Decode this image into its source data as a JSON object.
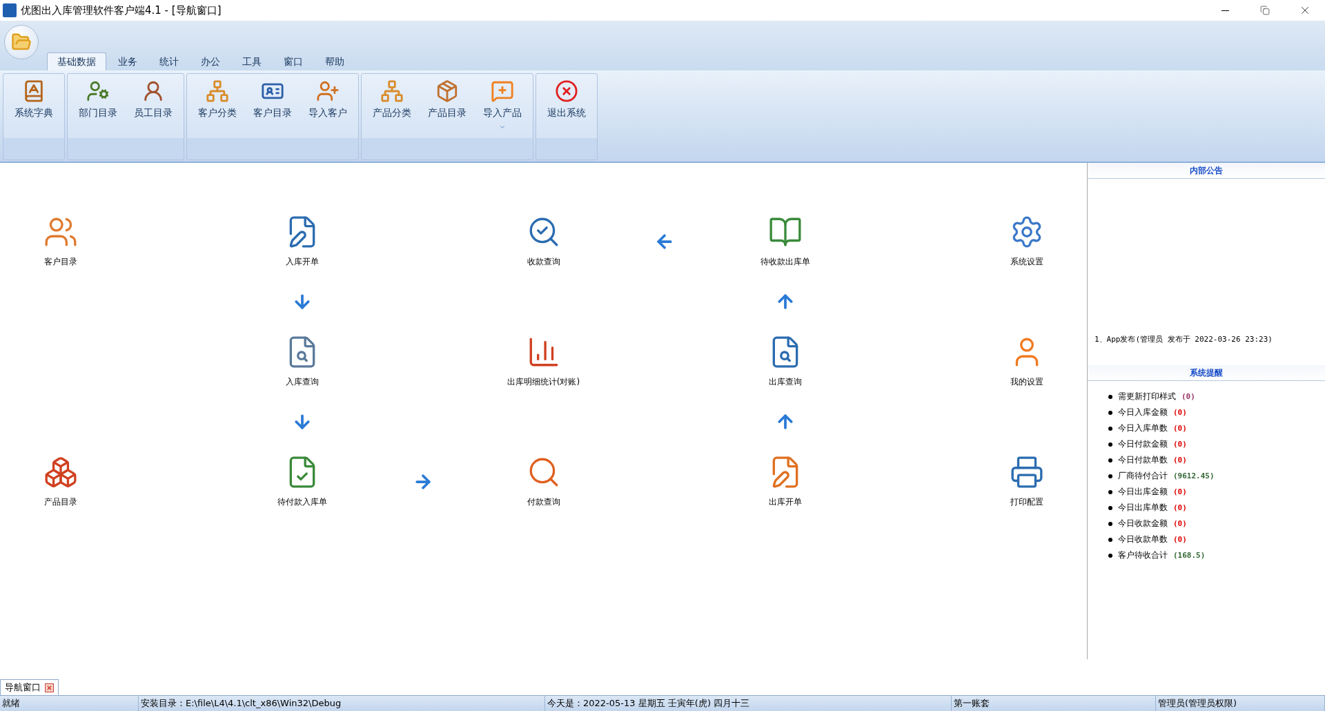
{
  "window": {
    "title": "优图出入库管理软件客户端4.1 - [导航窗口]"
  },
  "ribbon": {
    "tabs": [
      {
        "label": "基础数据",
        "selected": true
      },
      {
        "label": "业务",
        "selected": false
      },
      {
        "label": "统计",
        "selected": false
      },
      {
        "label": "办公",
        "selected": false
      },
      {
        "label": "工具",
        "selected": false
      },
      {
        "label": "窗口",
        "selected": false
      },
      {
        "label": "帮助",
        "selected": false
      }
    ],
    "groups": [
      {
        "buttons": [
          {
            "label": "系统字典",
            "has_menu": false
          }
        ]
      },
      {
        "buttons": [
          {
            "label": "部门目录",
            "has_menu": false
          },
          {
            "label": "员工目录",
            "has_menu": false
          }
        ]
      },
      {
        "buttons": [
          {
            "label": "客户分类",
            "has_menu": false
          },
          {
            "label": "客户目录",
            "has_menu": false
          },
          {
            "label": "导入客户",
            "has_menu": false
          }
        ]
      },
      {
        "buttons": [
          {
            "label": "产品分类",
            "has_menu": false
          },
          {
            "label": "产品目录",
            "has_menu": false
          },
          {
            "label": "导入产品",
            "has_menu": true
          }
        ]
      },
      {
        "buttons": [
          {
            "label": "退出系统",
            "has_menu": false
          }
        ]
      }
    ]
  },
  "navigator": {
    "rows": [
      [
        {
          "kind": "tile",
          "label": "客户目录"
        },
        {
          "kind": "empty"
        },
        {
          "kind": "tile",
          "label": "入库开单"
        },
        {
          "kind": "empty"
        },
        {
          "kind": "tile",
          "label": "收款查询"
        },
        {
          "kind": "arrow_left"
        },
        {
          "kind": "tile",
          "label": "待收款出库单"
        },
        {
          "kind": "empty"
        },
        {
          "kind": "tile",
          "label": "系统设置"
        }
      ],
      [
        {
          "kind": "empty"
        },
        {
          "kind": "empty"
        },
        {
          "kind": "arrow_down"
        },
        {
          "kind": "empty"
        },
        {
          "kind": "empty"
        },
        {
          "kind": "empty"
        },
        {
          "kind": "arrow_up"
        },
        {
          "kind": "empty"
        },
        {
          "kind": "empty"
        }
      ],
      [
        {
          "kind": "empty"
        },
        {
          "kind": "empty"
        },
        {
          "kind": "tile",
          "label": "入库查询"
        },
        {
          "kind": "empty"
        },
        {
          "kind": "tile",
          "label": "出库明细统计(对账)"
        },
        {
          "kind": "empty"
        },
        {
          "kind": "tile",
          "label": "出库查询"
        },
        {
          "kind": "empty"
        },
        {
          "kind": "tile",
          "label": "我的设置"
        }
      ],
      [
        {
          "kind": "empty"
        },
        {
          "kind": "empty"
        },
        {
          "kind": "arrow_down"
        },
        {
          "kind": "empty"
        },
        {
          "kind": "empty"
        },
        {
          "kind": "empty"
        },
        {
          "kind": "arrow_up"
        },
        {
          "kind": "empty"
        },
        {
          "kind": "empty"
        }
      ],
      [
        {
          "kind": "tile",
          "label": "产品目录"
        },
        {
          "kind": "empty"
        },
        {
          "kind": "tile",
          "label": "待付款入库单"
        },
        {
          "kind": "arrow_right"
        },
        {
          "kind": "tile",
          "label": "付款查询"
        },
        {
          "kind": "empty"
        },
        {
          "kind": "tile",
          "label": "出库开单"
        },
        {
          "kind": "empty"
        },
        {
          "kind": "tile",
          "label": "打印配置"
        }
      ]
    ]
  },
  "side_panel": {
    "notice_title": "内部公告",
    "notices": [
      "1、App发布(管理员 发布于 2022-03-26 23:23)"
    ],
    "reminder_title": "系统提醒",
    "reminders": [
      {
        "label": "需更新打印样式",
        "value": "(0)",
        "color": "#993366"
      },
      {
        "label": "今日入库金额",
        "value": "(0)",
        "color": "#e00000"
      },
      {
        "label": "今日入库单数",
        "value": "(0)",
        "color": "#e00000"
      },
      {
        "label": "今日付款金额",
        "value": "(0)",
        "color": "#e00000"
      },
      {
        "label": "今日付款单数",
        "value": "(0)",
        "color": "#e00000"
      },
      {
        "label": "厂商待付合计",
        "value": "(9612.45)",
        "color": "#336633"
      },
      {
        "label": "今日出库金额",
        "value": "(0)",
        "color": "#e00000"
      },
      {
        "label": "今日出库单数",
        "value": "(0)",
        "color": "#e00000"
      },
      {
        "label": "今日收款金额",
        "value": "(0)",
        "color": "#e00000"
      },
      {
        "label": "今日收款单数",
        "value": "(0)",
        "color": "#e00000"
      },
      {
        "label": "客户待收合计",
        "value": "(168.5)",
        "color": "#336633"
      }
    ]
  },
  "document_tabs": [
    {
      "label": "导航窗口",
      "selected": true
    }
  ],
  "status_bar": [
    "就绪",
    "安装目录：E:\\file\\L4\\4.1\\clt_x86\\Win32\\Debug",
    "今天是：2022-05-13 星期五 壬寅年(虎) 四月十三",
    "第一账套",
    "管理员(管理员权限)"
  ]
}
